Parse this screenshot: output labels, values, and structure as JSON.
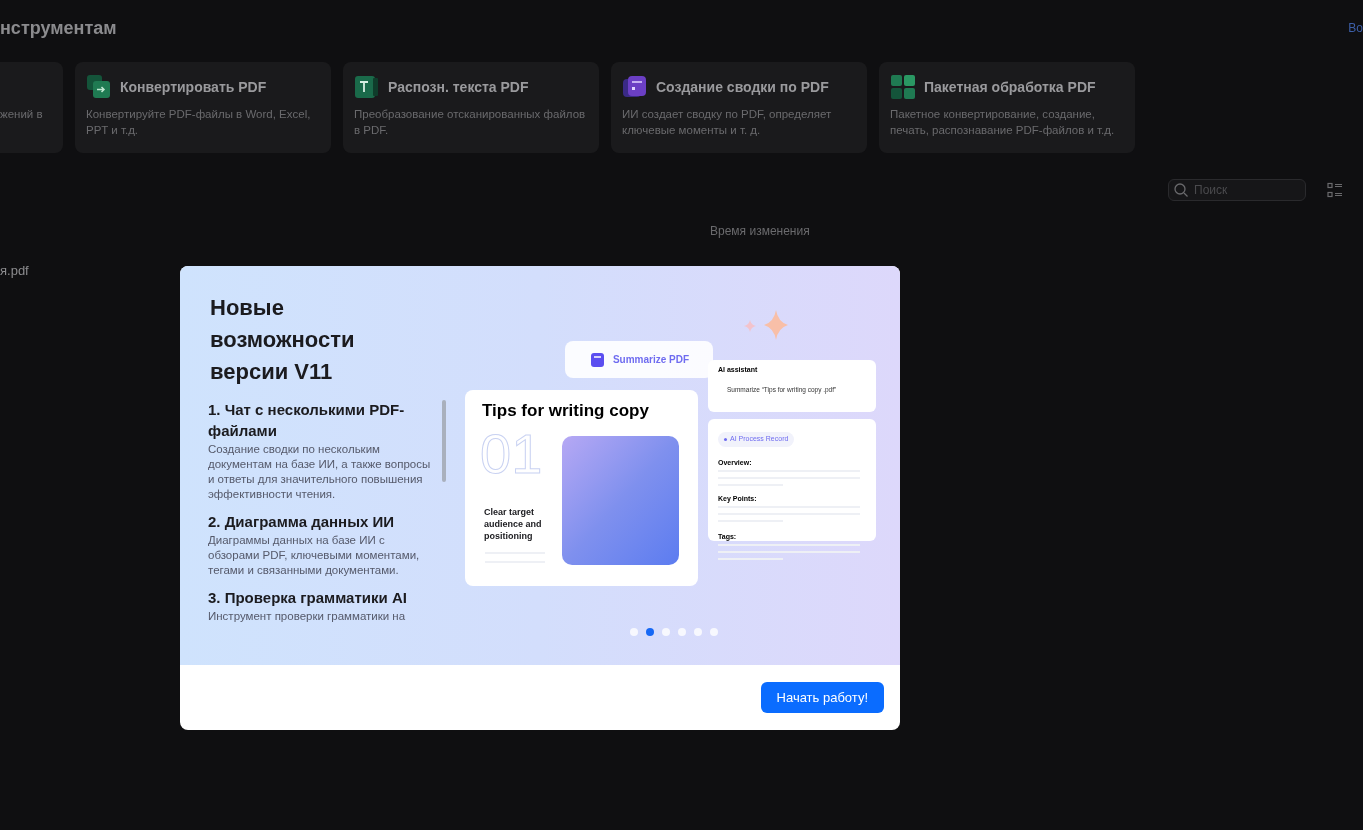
{
  "section_title": "нструментам",
  "top_link": "Во",
  "tool_cards": [
    {
      "kind": "partial",
      "description": "жений в"
    },
    {
      "kind": "convert",
      "title": "Конвертировать PDF",
      "description": "Конвертируйте PDF-файлы в Word, Excel, PPT и т.д."
    },
    {
      "kind": "ocr",
      "title": "Распозн. текста PDF",
      "description": "Преобразование отсканированных файлов в PDF."
    },
    {
      "kind": "summary",
      "title": "Создание сводки по PDF",
      "description": "ИИ создает сводку по PDF, определяет ключевые моменты и т. д."
    },
    {
      "kind": "batch",
      "title": "Пакетная обработка PDF",
      "description": "Пакетное конвертирование, создание, печать, распознавание PDF-файлов и т.д."
    }
  ],
  "search": {
    "placeholder": "Поиск"
  },
  "column_header": "Время изменения",
  "files": [
    {
      "name": "я.pdf"
    }
  ],
  "dialog": {
    "title": "Новые возможности версии V11",
    "features": [
      {
        "title": "1. Чат с несколькими PDF-файлами",
        "description": "Создание сводки по нескольким документам на базе ИИ, а также вопросы и ответы для значительного повышения эффективности чтения."
      },
      {
        "title": "2. Диаграмма данных ИИ",
        "description": "Диаграммы данных на базе ИИ с обзорами PDF, ключевыми моментами, тегами и связанными документами."
      },
      {
        "title": "3. Проверка грамматики AI",
        "description": "Инструмент проверки грамматики на"
      }
    ],
    "illustration": {
      "pill": "Summarize PDF",
      "doc_title": "Tips for writing copy",
      "doc_number": "01",
      "doc_caption": "Clear target audience and positioning",
      "assistant_label": "AI assistant",
      "assistant_prompt": "Summarize “Tips for writing copy .pdf”",
      "record_tag": "AI Process Record",
      "record_sections": [
        "Overview:",
        "Key Points:",
        "Tags:"
      ]
    },
    "carousel": [
      {
        "selected": false
      },
      {
        "selected": true
      },
      {
        "selected": false
      },
      {
        "selected": false
      },
      {
        "selected": false
      },
      {
        "selected": false
      }
    ],
    "button": "Начать работу!"
  }
}
